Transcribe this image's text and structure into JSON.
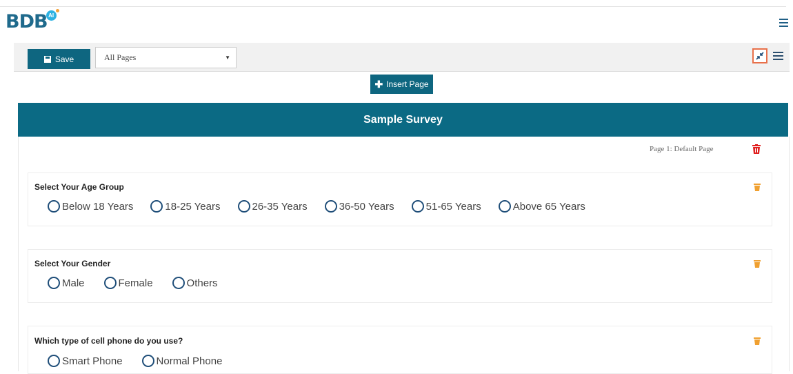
{
  "app": {
    "logo_text": "BDB",
    "logo_badge": "AI"
  },
  "toolbar": {
    "save_label": "Save",
    "page_select_value": "All Pages"
  },
  "insert_page_label": "Insert Page",
  "survey": {
    "title": "Sample Survey",
    "page_label": "Page 1:  Default Page",
    "questions": [
      {
        "title": "Select Your Age Group",
        "options": [
          "Below 18 Years",
          "18-25 Years",
          "26-35 Years",
          "36-50 Years",
          "51-65 Years",
          "Above 65 Years"
        ]
      },
      {
        "title": "Select Your Gender",
        "options": [
          "Male",
          "Female",
          "Others"
        ]
      },
      {
        "title": "Which type of cell phone do you use?",
        "options": [
          "Smart Phone",
          "Normal Phone"
        ]
      }
    ]
  },
  "colors": {
    "primary": "#0b6a84",
    "highlight": "#e8704a",
    "delete_red": "#e02020",
    "delete_orange": "#f0a030"
  }
}
